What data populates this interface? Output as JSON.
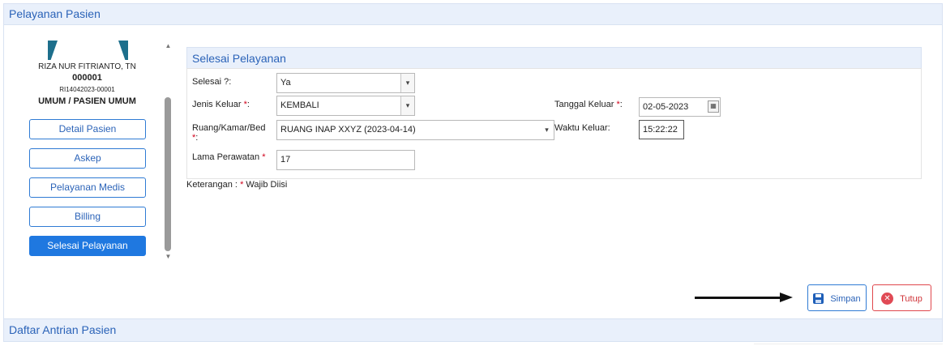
{
  "header": {
    "title": "Pelayanan Pasien"
  },
  "footer": {
    "title": "Daftar Antrian Pasien"
  },
  "patient": {
    "name": "RIZA NUR FITRIANTO, TN",
    "number": "000001",
    "registration": "RI14042023-00001",
    "type": "UMUM / PASIEN UMUM"
  },
  "nav": {
    "items": [
      {
        "label": "Detail Pasien"
      },
      {
        "label": "Askep"
      },
      {
        "label": "Pelayanan Medis"
      },
      {
        "label": "Billing"
      },
      {
        "label": "Selesai Pelayanan"
      }
    ],
    "active_index": 4
  },
  "section": {
    "title": "Selesai Pelayanan",
    "fields": {
      "selesai": {
        "label": "Selesai ?:",
        "value": "Ya"
      },
      "jenis_keluar": {
        "label": "Jenis Keluar ",
        "required": "*",
        "colon": ":",
        "value": "KEMBALI"
      },
      "ruang": {
        "label": "Ruang/Kamar/Bed",
        "required": "*",
        "colon": ":",
        "value": "RUANG INAP XXYZ (2023-04-14)"
      },
      "lama": {
        "label": "Lama Perawatan ",
        "required": "*",
        "value": "17"
      },
      "tanggal_keluar": {
        "label": "Tanggal Keluar ",
        "required": "*",
        "colon": ":",
        "value": "02-05-2023"
      },
      "waktu_keluar": {
        "label": "Waktu Keluar:",
        "value": "15:22:22"
      }
    }
  },
  "note": {
    "prefix": "Keterangan : ",
    "required": "*",
    "suffix": " Wajib Diisi"
  },
  "actions": {
    "save_label": "Simpan",
    "close_label": "Tutup"
  },
  "colors": {
    "accent": "#2b63b8",
    "active_button": "#1f78e0",
    "required": "#d0021b",
    "close": "#e04a55"
  }
}
